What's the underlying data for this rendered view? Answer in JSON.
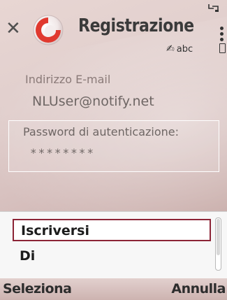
{
  "window": {
    "title": "Registrazione",
    "input_mode": "abc"
  },
  "form": {
    "email_label": "Indirizzo E-mail",
    "email_value": "NLUser@notify.net",
    "password_label": "Password di autenticazione:",
    "password_value": "********"
  },
  "options_menu": {
    "items": [
      {
        "label": "Iscriversi",
        "selected": true
      },
      {
        "label": "Di",
        "selected": false
      }
    ]
  },
  "softkeys": {
    "left": "Seleziona",
    "right": "Annulla"
  },
  "colors": {
    "selection_border": "#8c2436",
    "logo_red": "#e0392f"
  }
}
